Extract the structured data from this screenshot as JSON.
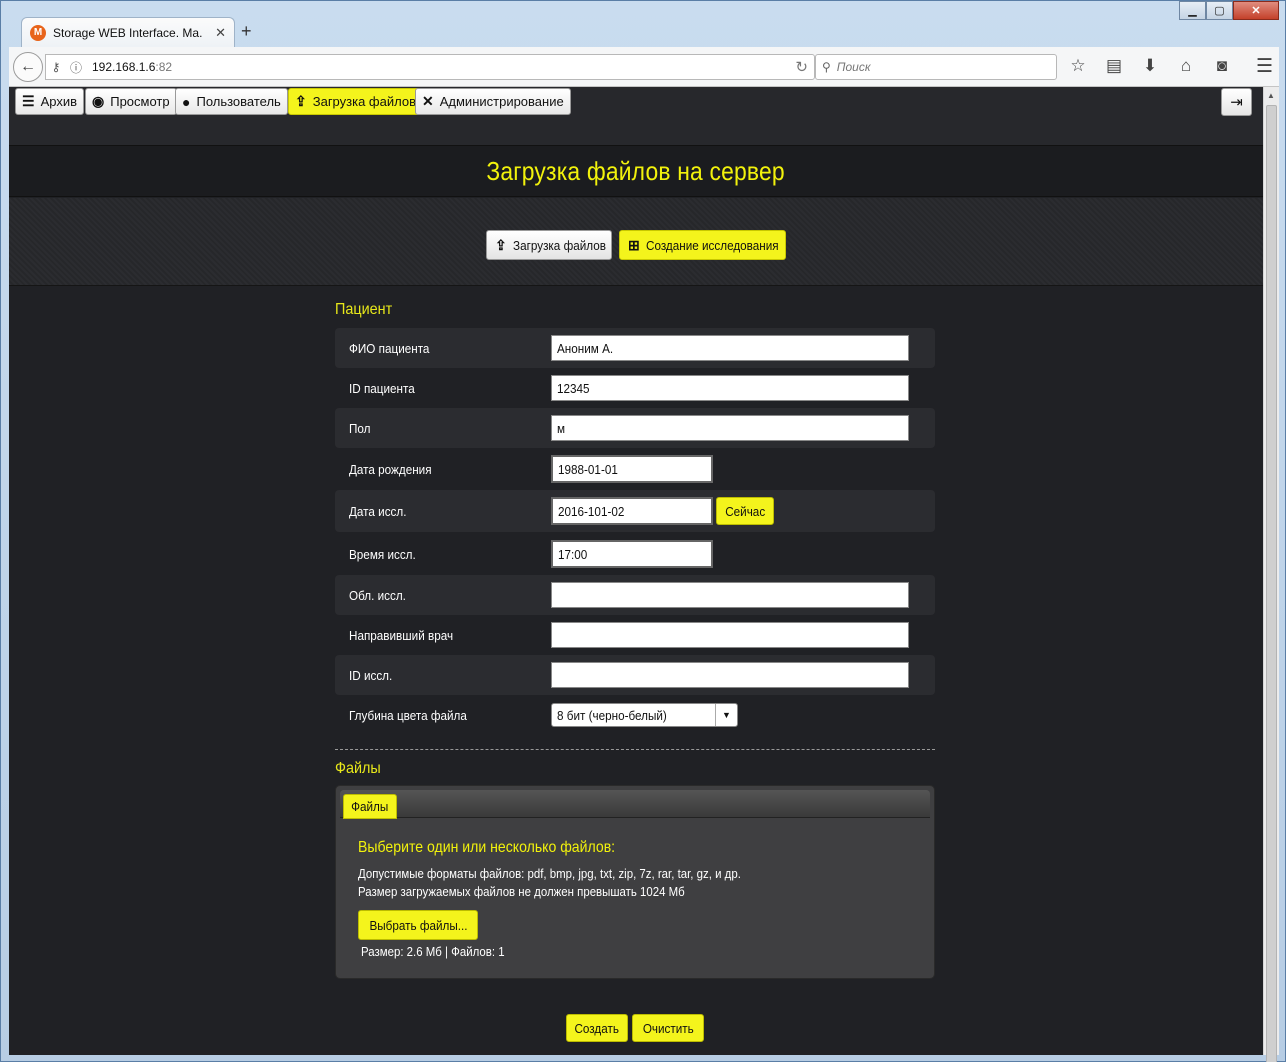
{
  "browser": {
    "tab_title": "Storage WEB Interface. Ma...",
    "url_host": "192.168.1.6",
    "url_port": ":82",
    "search_placeholder": "Поиск"
  },
  "topmenu": {
    "archive": "Архив",
    "view": "Просмотр",
    "user": "Пользователь",
    "upload": "Загрузка файлов",
    "admin": "Администрирование"
  },
  "page": {
    "title": "Загрузка файлов на сервер",
    "upload_btn": "Загрузка файлов",
    "create_study_btn": "Создание исследования"
  },
  "patient": {
    "heading": "Пациент",
    "fields": [
      {
        "label": "ФИО пациента",
        "value": "Аноним А."
      },
      {
        "label": "ID пациента",
        "value": "12345"
      },
      {
        "label": "Пол",
        "value": "м"
      },
      {
        "label": "Дата рождения",
        "value": "1988-01-01"
      },
      {
        "label": "Дата иссл.",
        "value": "2016-101-02"
      },
      {
        "label": "Время иссл.",
        "value": "17:00"
      },
      {
        "label": "Обл. иссл.",
        "value": ""
      },
      {
        "label": "Направивший врач",
        "value": ""
      },
      {
        "label": "ID иссл.",
        "value": ""
      },
      {
        "label": "Глубина цвета файла",
        "value": "8 бит (черно-белый)"
      }
    ],
    "now_btn": "Сейчас"
  },
  "files": {
    "heading": "Файлы",
    "tab": "Файлы",
    "choose_heading": "Выберите один или несколько файлов:",
    "formats": "Допустимые форматы файлов: pdf, bmp, jpg, txt, zip, 7z, rar, tar, gz, и др.",
    "size_limit": "Размер загружаемых файлов не должен превышать 1024 Мб",
    "choose_btn": "Выбрать файлы...",
    "summary": "Размер: 2.6 Мб | Файлов: 1"
  },
  "actions": {
    "create": "Создать",
    "clear": "Очистить"
  },
  "colors": {
    "accent": "#f4f41c",
    "background": "#202125"
  }
}
